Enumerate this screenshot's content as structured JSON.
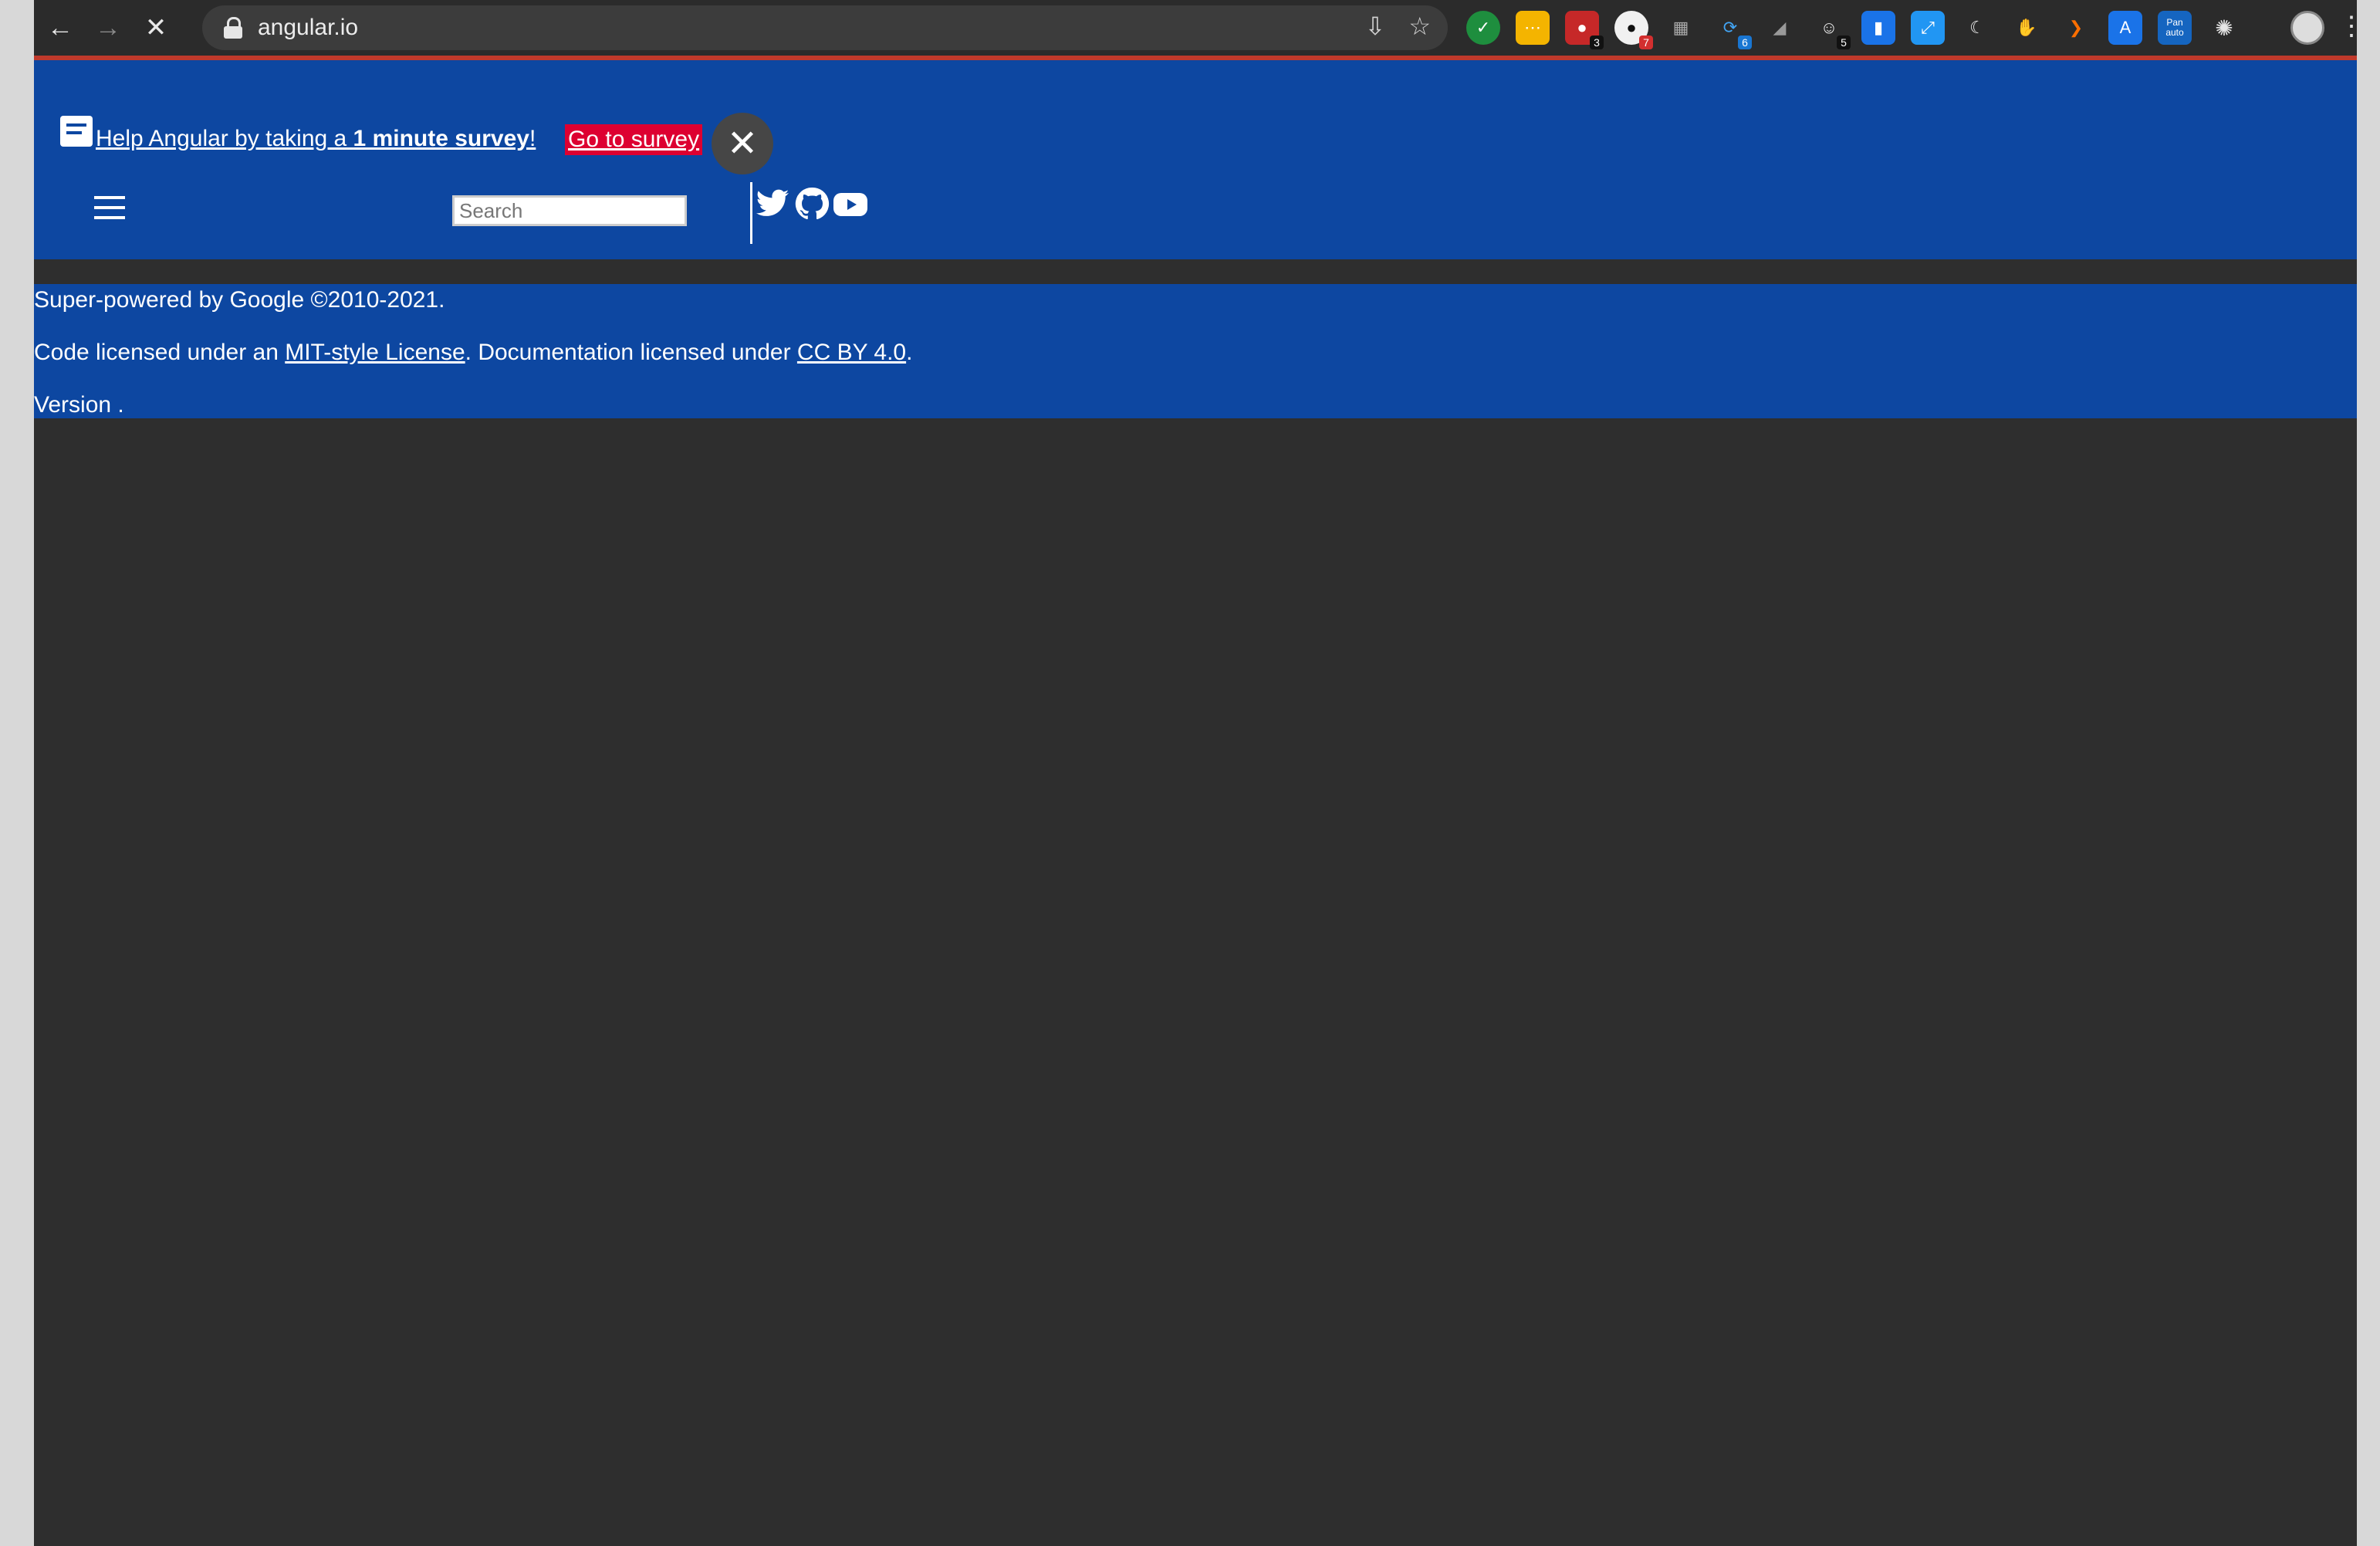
{
  "browser": {
    "url": "angular.io",
    "extension_badges": [
      "3",
      "7",
      "6",
      "5"
    ],
    "ext_label_pan": "Pan",
    "ext_label_auto": "auto"
  },
  "survey": {
    "text_before": "Help Angular by taking a ",
    "text_bold": "1 minute survey",
    "text_after": "!",
    "link_label": "Go to survey"
  },
  "header": {
    "search_placeholder": "Search"
  },
  "footer": {
    "powered": "Super-powered by Google ©2010-2021.",
    "license_prefix": "Code licensed under an ",
    "mit_link": "MIT-style License",
    "license_middle": ". Documentation licensed under ",
    "cc_link": "CC BY 4.0",
    "license_suffix": ".",
    "version": "Version ."
  },
  "colors": {
    "brand_blue": "#0d47a1",
    "survey_red": "#dd0031",
    "page_bg": "#2e2e2e"
  },
  "icons": [
    "back-icon",
    "forward-icon",
    "stop-icon",
    "lock-icon",
    "install-icon",
    "star-icon",
    "menu-icon",
    "twitter-icon",
    "github-icon",
    "youtube-icon",
    "close-icon",
    "feedback-icon",
    "extensions-icon",
    "more-icon"
  ]
}
